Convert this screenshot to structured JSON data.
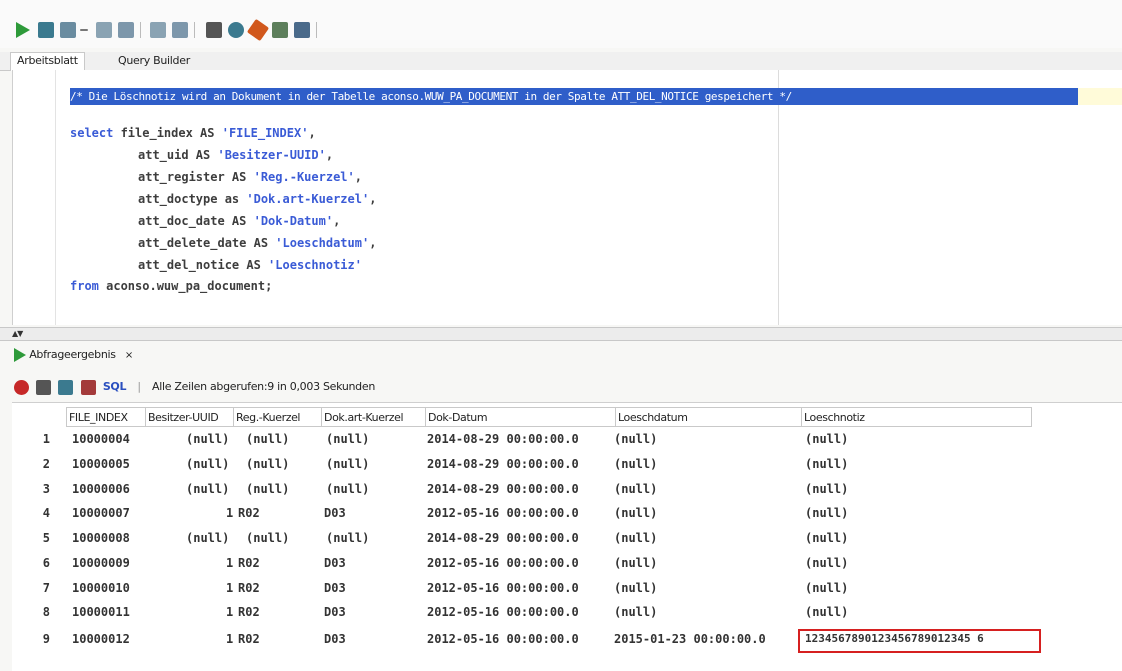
{
  "tabs": [
    {
      "label": "Arbeitsblatt"
    },
    {
      "label": "Query Builder"
    }
  ],
  "editor": {
    "comment": "/* Die Löschnotiz wird an Dokument in der Tabelle aconso.WUW_PA_DOCUMENT in der Spalte ATT_DEL_NOTICE gespeichert */",
    "lines": [
      {
        "kw": "select",
        "text": " file_index AS ",
        "str": "'FILE_INDEX'",
        "tail": ","
      },
      {
        "kw": "",
        "text": "att_uid AS ",
        "str": "'Besitzer-UUID'",
        "tail": ","
      },
      {
        "kw": "",
        "text": "att_register AS ",
        "str": "'Reg.-Kuerzel'",
        "tail": ","
      },
      {
        "kw": "",
        "text": "att_doctype as ",
        "str": "'Dok.art-Kuerzel'",
        "tail": ","
      },
      {
        "kw": "",
        "text": "att_doc_date AS ",
        "str": "'Dok-Datum'",
        "tail": ","
      },
      {
        "kw": "",
        "text": "att_delete_date AS ",
        "str": "'Loeschdatum'",
        "tail": ","
      },
      {
        "kw": "",
        "text": "att_del_notice AS ",
        "str": "'Loeschnotiz'",
        "tail": ""
      },
      {
        "kw": "from",
        "text": " aconso.wuw_pa_document;",
        "str": "",
        "tail": ""
      }
    ]
  },
  "results": {
    "tab_label": "Abfrageergebnis",
    "tab_close": "×",
    "sql_label": "SQL",
    "status": "Alle Zeilen abgerufen:9 in 0,003 Sekunden",
    "columns": [
      "FILE_INDEX",
      "Besitzer-UUID",
      "Reg.-Kuerzel",
      "Dok.art-Kuerzel",
      "Dok-Datum",
      "Loeschdatum",
      "Loeschnotiz"
    ],
    "rows": [
      {
        "n": "1",
        "file_index": "10000004",
        "uid": "(null)",
        "reg": "(null)",
        "doctype": "(null)",
        "doc_date": "2014-08-29 00:00:00.0",
        "del_date": "(null)",
        "notice": "(null)"
      },
      {
        "n": "2",
        "file_index": "10000005",
        "uid": "(null)",
        "reg": "(null)",
        "doctype": "(null)",
        "doc_date": "2014-08-29 00:00:00.0",
        "del_date": "(null)",
        "notice": "(null)"
      },
      {
        "n": "3",
        "file_index": "10000006",
        "uid": "(null)",
        "reg": "(null)",
        "doctype": "(null)",
        "doc_date": "2014-08-29 00:00:00.0",
        "del_date": "(null)",
        "notice": "(null)"
      },
      {
        "n": "4",
        "file_index": "10000007",
        "uid": "1",
        "reg": "R02",
        "doctype": "D03",
        "doc_date": "2012-05-16 00:00:00.0",
        "del_date": "(null)",
        "notice": "(null)"
      },
      {
        "n": "5",
        "file_index": "10000008",
        "uid": "(null)",
        "reg": "(null)",
        "doctype": "(null)",
        "doc_date": "2014-08-29 00:00:00.0",
        "del_date": "(null)",
        "notice": "(null)"
      },
      {
        "n": "6",
        "file_index": "10000009",
        "uid": "1",
        "reg": "R02",
        "doctype": "D03",
        "doc_date": "2012-05-16 00:00:00.0",
        "del_date": "(null)",
        "notice": "(null)"
      },
      {
        "n": "7",
        "file_index": "10000010",
        "uid": "1",
        "reg": "R02",
        "doctype": "D03",
        "doc_date": "2012-05-16 00:00:00.0",
        "del_date": "(null)",
        "notice": "(null)"
      },
      {
        "n": "8",
        "file_index": "10000011",
        "uid": "1",
        "reg": "R02",
        "doctype": "D03",
        "doc_date": "2012-05-16 00:00:00.0",
        "del_date": "(null)",
        "notice": "(null)"
      },
      {
        "n": "9",
        "file_index": "10000012",
        "uid": "1",
        "reg": "R02",
        "doctype": "D03",
        "doc_date": "2012-05-16 00:00:00.0",
        "del_date": "2015-01-23 00:00:00.0",
        "notice": "1234567890123456789012345 6"
      }
    ]
  },
  "toolbar_icons": [
    {
      "name": "run-statement-icon",
      "color": "#2e9a3a"
    },
    {
      "name": "run-script-icon",
      "color": "#3b7a8f"
    },
    {
      "name": "commit-icon",
      "color": "#6a8ca0"
    },
    {
      "name": "dropdown-icon",
      "color": "#777777"
    },
    {
      "name": "rollback-icon",
      "color": "#6a8ca0"
    },
    {
      "name": "explain-plan-icon",
      "color": "#6a8ca0"
    },
    {
      "name": "autotrace-icon",
      "color": "#6a8ca0"
    },
    {
      "name": "sql-tuning-icon",
      "color": "#6a8ca0"
    },
    {
      "name": "unshared-sql-icon",
      "color": "#555555"
    },
    {
      "name": "to-upper-icon",
      "color": "#3b7a8f"
    },
    {
      "name": "clear-icon",
      "color": "#d1581c"
    },
    {
      "name": "history-icon",
      "color": "#5d7f5b"
    },
    {
      "name": "format-icon",
      "color": "#4a6a8a"
    }
  ]
}
